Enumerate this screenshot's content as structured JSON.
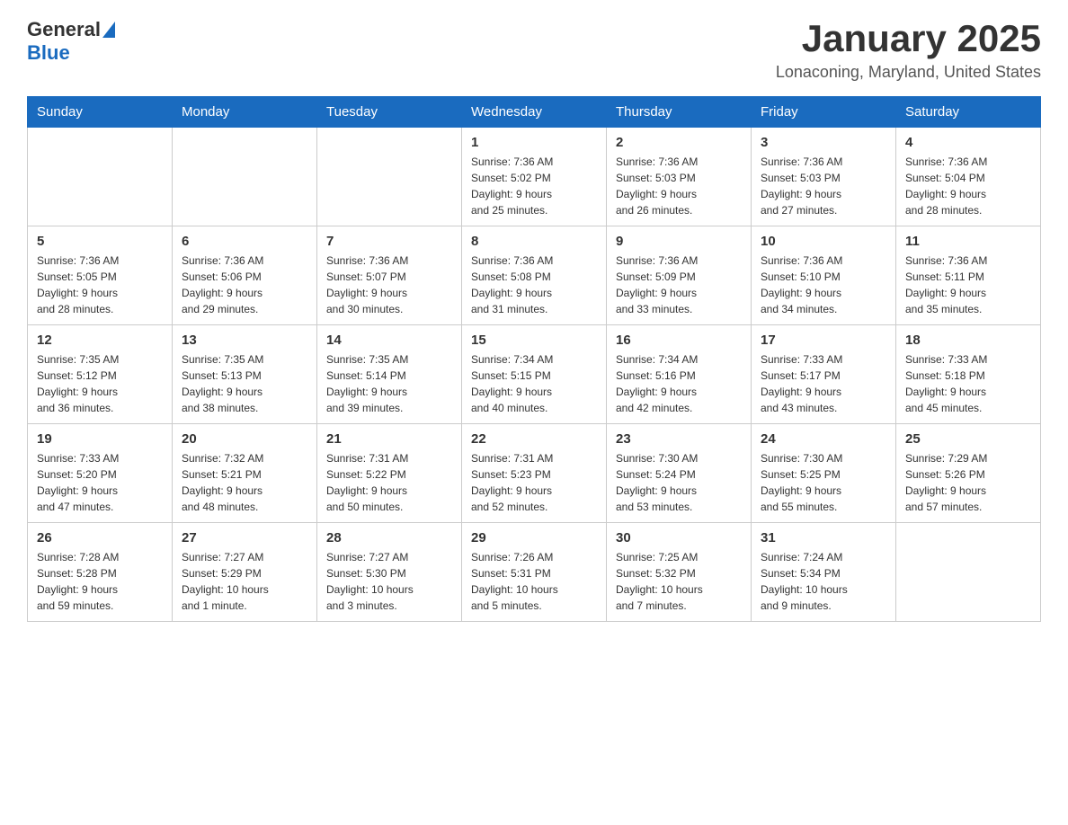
{
  "header": {
    "logo": {
      "general": "General",
      "blue": "Blue"
    },
    "title": "January 2025",
    "location": "Lonaconing, Maryland, United States"
  },
  "days_of_week": [
    "Sunday",
    "Monday",
    "Tuesday",
    "Wednesday",
    "Thursday",
    "Friday",
    "Saturday"
  ],
  "weeks": [
    [
      {
        "day": "",
        "info": ""
      },
      {
        "day": "",
        "info": ""
      },
      {
        "day": "",
        "info": ""
      },
      {
        "day": "1",
        "info": "Sunrise: 7:36 AM\nSunset: 5:02 PM\nDaylight: 9 hours\nand 25 minutes."
      },
      {
        "day": "2",
        "info": "Sunrise: 7:36 AM\nSunset: 5:03 PM\nDaylight: 9 hours\nand 26 minutes."
      },
      {
        "day": "3",
        "info": "Sunrise: 7:36 AM\nSunset: 5:03 PM\nDaylight: 9 hours\nand 27 minutes."
      },
      {
        "day": "4",
        "info": "Sunrise: 7:36 AM\nSunset: 5:04 PM\nDaylight: 9 hours\nand 28 minutes."
      }
    ],
    [
      {
        "day": "5",
        "info": "Sunrise: 7:36 AM\nSunset: 5:05 PM\nDaylight: 9 hours\nand 28 minutes."
      },
      {
        "day": "6",
        "info": "Sunrise: 7:36 AM\nSunset: 5:06 PM\nDaylight: 9 hours\nand 29 minutes."
      },
      {
        "day": "7",
        "info": "Sunrise: 7:36 AM\nSunset: 5:07 PM\nDaylight: 9 hours\nand 30 minutes."
      },
      {
        "day": "8",
        "info": "Sunrise: 7:36 AM\nSunset: 5:08 PM\nDaylight: 9 hours\nand 31 minutes."
      },
      {
        "day": "9",
        "info": "Sunrise: 7:36 AM\nSunset: 5:09 PM\nDaylight: 9 hours\nand 33 minutes."
      },
      {
        "day": "10",
        "info": "Sunrise: 7:36 AM\nSunset: 5:10 PM\nDaylight: 9 hours\nand 34 minutes."
      },
      {
        "day": "11",
        "info": "Sunrise: 7:36 AM\nSunset: 5:11 PM\nDaylight: 9 hours\nand 35 minutes."
      }
    ],
    [
      {
        "day": "12",
        "info": "Sunrise: 7:35 AM\nSunset: 5:12 PM\nDaylight: 9 hours\nand 36 minutes."
      },
      {
        "day": "13",
        "info": "Sunrise: 7:35 AM\nSunset: 5:13 PM\nDaylight: 9 hours\nand 38 minutes."
      },
      {
        "day": "14",
        "info": "Sunrise: 7:35 AM\nSunset: 5:14 PM\nDaylight: 9 hours\nand 39 minutes."
      },
      {
        "day": "15",
        "info": "Sunrise: 7:34 AM\nSunset: 5:15 PM\nDaylight: 9 hours\nand 40 minutes."
      },
      {
        "day": "16",
        "info": "Sunrise: 7:34 AM\nSunset: 5:16 PM\nDaylight: 9 hours\nand 42 minutes."
      },
      {
        "day": "17",
        "info": "Sunrise: 7:33 AM\nSunset: 5:17 PM\nDaylight: 9 hours\nand 43 minutes."
      },
      {
        "day": "18",
        "info": "Sunrise: 7:33 AM\nSunset: 5:18 PM\nDaylight: 9 hours\nand 45 minutes."
      }
    ],
    [
      {
        "day": "19",
        "info": "Sunrise: 7:33 AM\nSunset: 5:20 PM\nDaylight: 9 hours\nand 47 minutes."
      },
      {
        "day": "20",
        "info": "Sunrise: 7:32 AM\nSunset: 5:21 PM\nDaylight: 9 hours\nand 48 minutes."
      },
      {
        "day": "21",
        "info": "Sunrise: 7:31 AM\nSunset: 5:22 PM\nDaylight: 9 hours\nand 50 minutes."
      },
      {
        "day": "22",
        "info": "Sunrise: 7:31 AM\nSunset: 5:23 PM\nDaylight: 9 hours\nand 52 minutes."
      },
      {
        "day": "23",
        "info": "Sunrise: 7:30 AM\nSunset: 5:24 PM\nDaylight: 9 hours\nand 53 minutes."
      },
      {
        "day": "24",
        "info": "Sunrise: 7:30 AM\nSunset: 5:25 PM\nDaylight: 9 hours\nand 55 minutes."
      },
      {
        "day": "25",
        "info": "Sunrise: 7:29 AM\nSunset: 5:26 PM\nDaylight: 9 hours\nand 57 minutes."
      }
    ],
    [
      {
        "day": "26",
        "info": "Sunrise: 7:28 AM\nSunset: 5:28 PM\nDaylight: 9 hours\nand 59 minutes."
      },
      {
        "day": "27",
        "info": "Sunrise: 7:27 AM\nSunset: 5:29 PM\nDaylight: 10 hours\nand 1 minute."
      },
      {
        "day": "28",
        "info": "Sunrise: 7:27 AM\nSunset: 5:30 PM\nDaylight: 10 hours\nand 3 minutes."
      },
      {
        "day": "29",
        "info": "Sunrise: 7:26 AM\nSunset: 5:31 PM\nDaylight: 10 hours\nand 5 minutes."
      },
      {
        "day": "30",
        "info": "Sunrise: 7:25 AM\nSunset: 5:32 PM\nDaylight: 10 hours\nand 7 minutes."
      },
      {
        "day": "31",
        "info": "Sunrise: 7:24 AM\nSunset: 5:34 PM\nDaylight: 10 hours\nand 9 minutes."
      },
      {
        "day": "",
        "info": ""
      }
    ]
  ]
}
